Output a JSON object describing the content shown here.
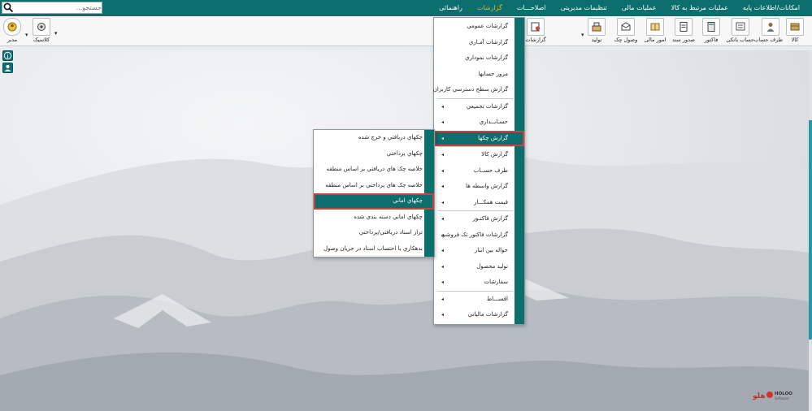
{
  "menubar": {
    "items": [
      {
        "label": "امکانات/اطلاعات پایه"
      },
      {
        "label": "عملیات مرتبط به کالا"
      },
      {
        "label": "عملیات مالی"
      },
      {
        "label": "تنظیمات مدیریتی"
      },
      {
        "label": "اصلاحـــات"
      },
      {
        "label": "گزارشات",
        "active": true
      },
      {
        "label": "راهنمائی"
      }
    ],
    "search_placeholder": "جستجو..."
  },
  "toolbar": {
    "buttons": [
      {
        "label": "کالا",
        "icon": "box-icon"
      },
      {
        "label": "طرف حساب",
        "icon": "person-icon"
      },
      {
        "label": "حساب بانکی",
        "icon": "bank-icon"
      },
      {
        "label": "فاکتور",
        "icon": "calculator-icon"
      },
      {
        "label": "صدور سند",
        "icon": "document-icon"
      },
      {
        "label": "امور مالی",
        "icon": "finance-icon"
      },
      {
        "label": "وصول چک",
        "icon": "cheque-icon"
      },
      {
        "label": "تولید",
        "icon": "production-icon"
      },
      {
        "label": "گزارشات",
        "icon": "report-icon"
      },
      {
        "label": "کلاسیک",
        "icon": "classic-icon"
      },
      {
        "label": "مدیر",
        "icon": "manager-icon"
      }
    ]
  },
  "reports_menu": {
    "items": [
      {
        "label": "گزارشات عمومي",
        "submenu": false
      },
      {
        "label": "گزارشات آمـاري",
        "submenu": false
      },
      {
        "label": "گزارشات نموداري",
        "submenu": false
      },
      {
        "label": "مرور حسابها",
        "submenu": false
      },
      {
        "label": "گزارش سطح دسترسي کاربران",
        "submenu": false
      },
      {
        "label": "گزارشات تجميعي",
        "submenu": true
      },
      {
        "label": "حسـابــداري",
        "submenu": true
      },
      {
        "label": "گزارش چکها",
        "submenu": true,
        "highlighted": true
      },
      {
        "label": "گزارش کالا",
        "submenu": true
      },
      {
        "label": "طرف حســاب",
        "submenu": true
      },
      {
        "label": "گزارش واسطه ها",
        "submenu": true
      },
      {
        "label": "قيمت همکـــار",
        "submenu": true
      },
      {
        "label": "گزارش فاکتـور",
        "submenu": true
      },
      {
        "label": "گزارشات فاکتور تک فروشي",
        "submenu": true
      },
      {
        "label": "حواله بين انبار",
        "submenu": true
      },
      {
        "label": "توليد محصول",
        "submenu": true
      },
      {
        "label": "سفارشات",
        "submenu": true
      },
      {
        "label": "اقســـاط",
        "submenu": true
      },
      {
        "label": "گزارشات مالياتي",
        "submenu": true
      }
    ]
  },
  "cheques_submenu": {
    "items": [
      {
        "label": "چکهاي دريافتي و خرج شده"
      },
      {
        "label": "چکهاي پرداختي"
      },
      {
        "label": "خلاصه چک هاي دريافتي بر اساس منطقه"
      },
      {
        "label": "خلاصه چک هاي پرداختي بر اساس منطقه"
      },
      {
        "label": "چکهاي اماني",
        "highlighted": true
      },
      {
        "label": "چکهاي اماني دسته بندي شده"
      },
      {
        "label": "تراز اسناد دريافتي/پرداختي"
      },
      {
        "label": "بدهکاري با احتساب اسناد در جريان وصول"
      }
    ]
  },
  "logo": {
    "brand_text": "HOLOO",
    "brand_sub": "Software",
    "brand_fa": "هلو"
  },
  "colors": {
    "primary": "#0d6e6e",
    "active_menu": "#f0b400",
    "highlight_border": "#c9433a"
  }
}
